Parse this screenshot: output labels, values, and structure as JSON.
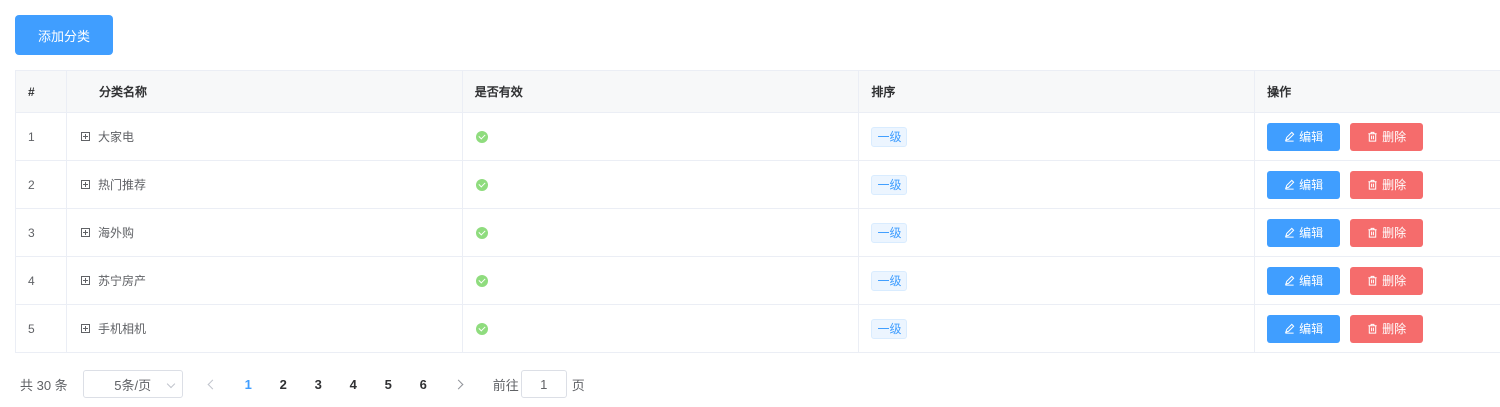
{
  "toolbar": {
    "add_label": "添加分类"
  },
  "table": {
    "columns": [
      "#",
      "分类名称",
      "是否有效",
      "排序",
      "操作"
    ],
    "rows": [
      {
        "index": "1",
        "name": "大家电",
        "valid": true,
        "level": "一级"
      },
      {
        "index": "2",
        "name": "热门推荐",
        "valid": true,
        "level": "一级"
      },
      {
        "index": "3",
        "name": "海外购",
        "valid": true,
        "level": "一级"
      },
      {
        "index": "4",
        "name": "苏宁房产",
        "valid": true,
        "level": "一级"
      },
      {
        "index": "5",
        "name": "手机相机",
        "valid": true,
        "level": "一级"
      }
    ],
    "actions": {
      "edit": "编辑",
      "delete": "删除"
    }
  },
  "pagination": {
    "total_text": "共 30 条",
    "page_size": "5条/页",
    "pages": [
      "1",
      "2",
      "3",
      "4",
      "5",
      "6"
    ],
    "current_page": "1",
    "goto_prefix": "前往",
    "goto_value": "1",
    "goto_suffix": "页"
  },
  "colors": {
    "primary": "#409eff",
    "danger": "#f56c6c",
    "success": "#8fdc7e"
  },
  "icons": {
    "expand": "plus-square-icon",
    "valid": "check-circle-icon",
    "edit": "pencil-icon",
    "delete": "trash-icon"
  }
}
